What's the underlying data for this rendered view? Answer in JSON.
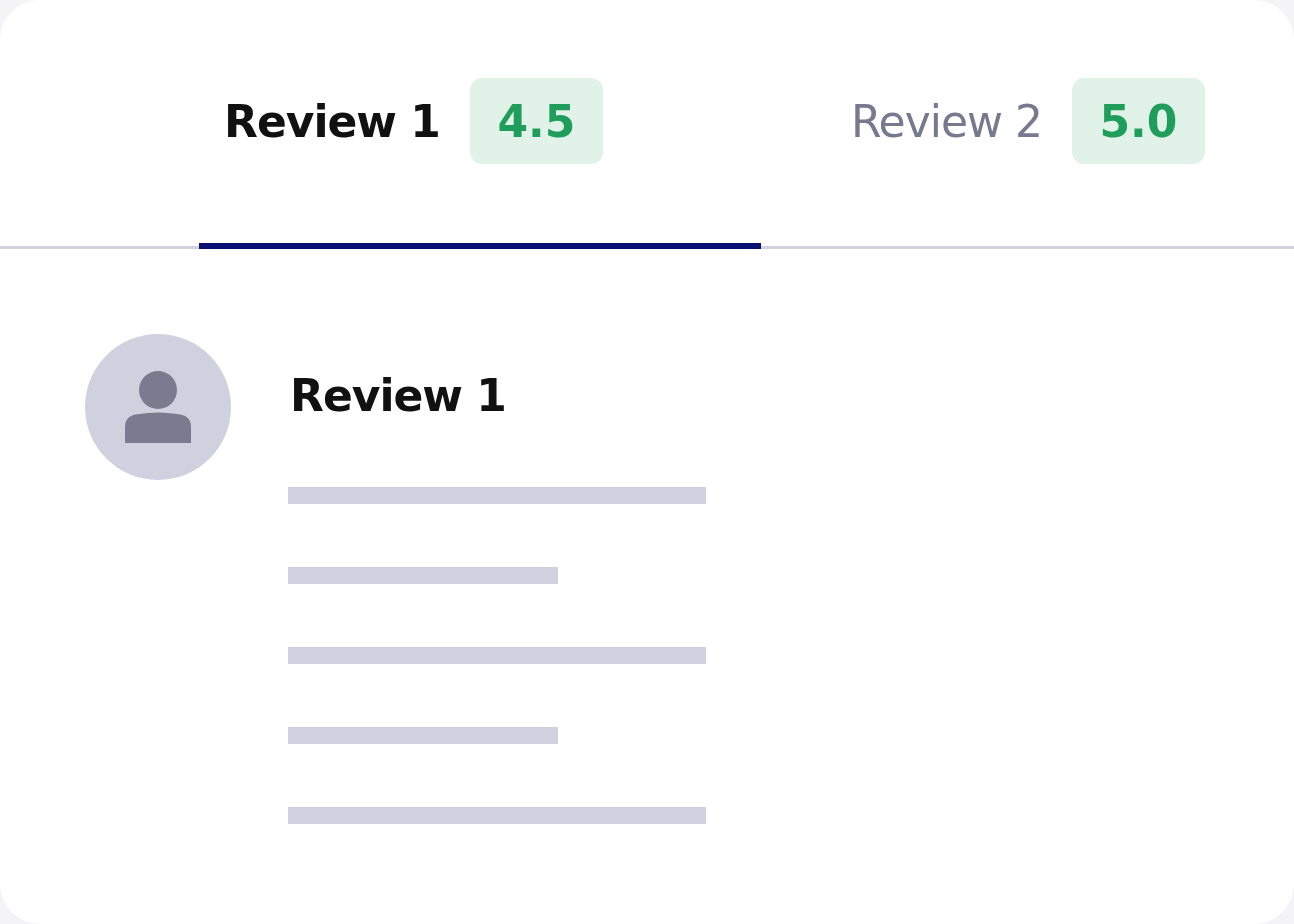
{
  "tabs": [
    {
      "label": "Review 1",
      "rating": "4.5",
      "selected": true
    },
    {
      "label": "Review 2",
      "rating": "5.0",
      "selected": false
    }
  ],
  "review": {
    "title": "Review 1"
  }
}
